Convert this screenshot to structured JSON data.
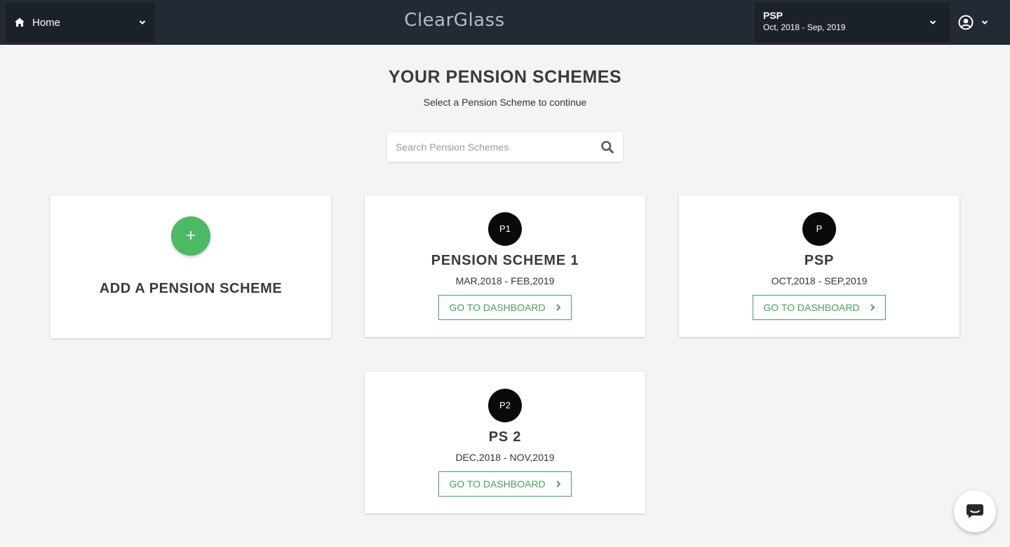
{
  "topbar": {
    "home_label": "Home",
    "brand": "ClearGlass",
    "current_scheme": {
      "name": "PSP",
      "period": "Oct, 2018 - Sep, 2019"
    }
  },
  "page": {
    "title": "YOUR PENSION SCHEMES",
    "subtitle": "Select a Pension Scheme to continue"
  },
  "search": {
    "placeholder": "Search Pension Schemes",
    "value": ""
  },
  "add_card": {
    "icon_glyph": "+",
    "label": "ADD A PENSION SCHEME"
  },
  "schemes": [
    {
      "initials": "P1",
      "name": "PENSION SCHEME 1",
      "period": "MAR,2018 - FEB,2019",
      "button": "GO TO DASHBOARD"
    },
    {
      "initials": "P",
      "name": "PSP",
      "period": "OCT,2018 - SEP,2019",
      "button": "GO TO DASHBOARD"
    },
    {
      "initials": "P2",
      "name": "PS 2",
      "period": "DEC,2018 - NOV,2019",
      "button": "GO TO DASHBOARD"
    }
  ],
  "colors": {
    "topbar": "#222a33",
    "accent_green": "#4cb964",
    "button_green": "#3da55a",
    "avatar": "#0a0a0a"
  },
  "icons": [
    "home-icon",
    "chevron-down-icon",
    "user-circle-icon",
    "search-icon",
    "plus-icon",
    "chevron-right-icon",
    "chat-icon"
  ]
}
